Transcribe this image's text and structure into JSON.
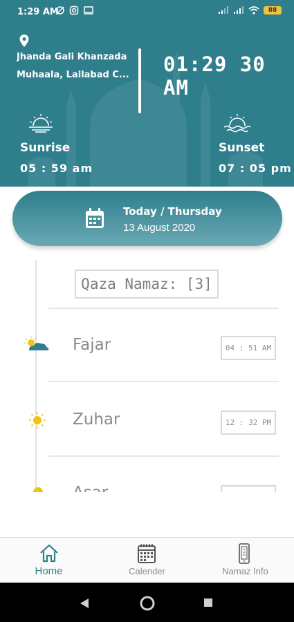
{
  "status_bar": {
    "time": "1:29 AM",
    "battery": "88",
    "icons": [
      "sync-off-icon",
      "instagram-icon",
      "screen-cast-icon",
      "signal-icon",
      "signal-icon",
      "wifi-icon",
      "battery-icon"
    ]
  },
  "header": {
    "location_line1": "Jhanda Gali Khanzada",
    "location_line2": "Muhaala, Lailabad C...",
    "clock": "01:29 30 AM",
    "sunrise_label": "Sunrise",
    "sunrise_time": "05 : 59 am",
    "sunset_label": "Sunset",
    "sunset_time": "07 : 05 pm",
    "background_color": "#2f7e8c"
  },
  "date_bar": {
    "day": "Today / Thursday",
    "date": "13 August 2020"
  },
  "qaza": {
    "label": "Qaza Namaz: [3]"
  },
  "prayers": [
    {
      "name": "Fajar",
      "time": "04 : 51 AM",
      "icon": "cloudy-sun-icon"
    },
    {
      "name": "Zuhar",
      "time": "12 : 32 PM",
      "icon": "sun-icon"
    },
    {
      "name": "Asar",
      "time": "",
      "icon": "cloudy-sun-icon"
    }
  ],
  "bottom_nav": {
    "items": [
      {
        "label": "Home",
        "icon": "home-icon",
        "active": true
      },
      {
        "label": "Calender",
        "icon": "calendar-icon",
        "active": false
      },
      {
        "label": "Namaz Info",
        "icon": "phone-info-icon",
        "active": false
      }
    ],
    "accent_color": "#2f7e8c"
  },
  "system_nav": [
    "back-icon",
    "home-circle-icon",
    "recents-icon"
  ]
}
